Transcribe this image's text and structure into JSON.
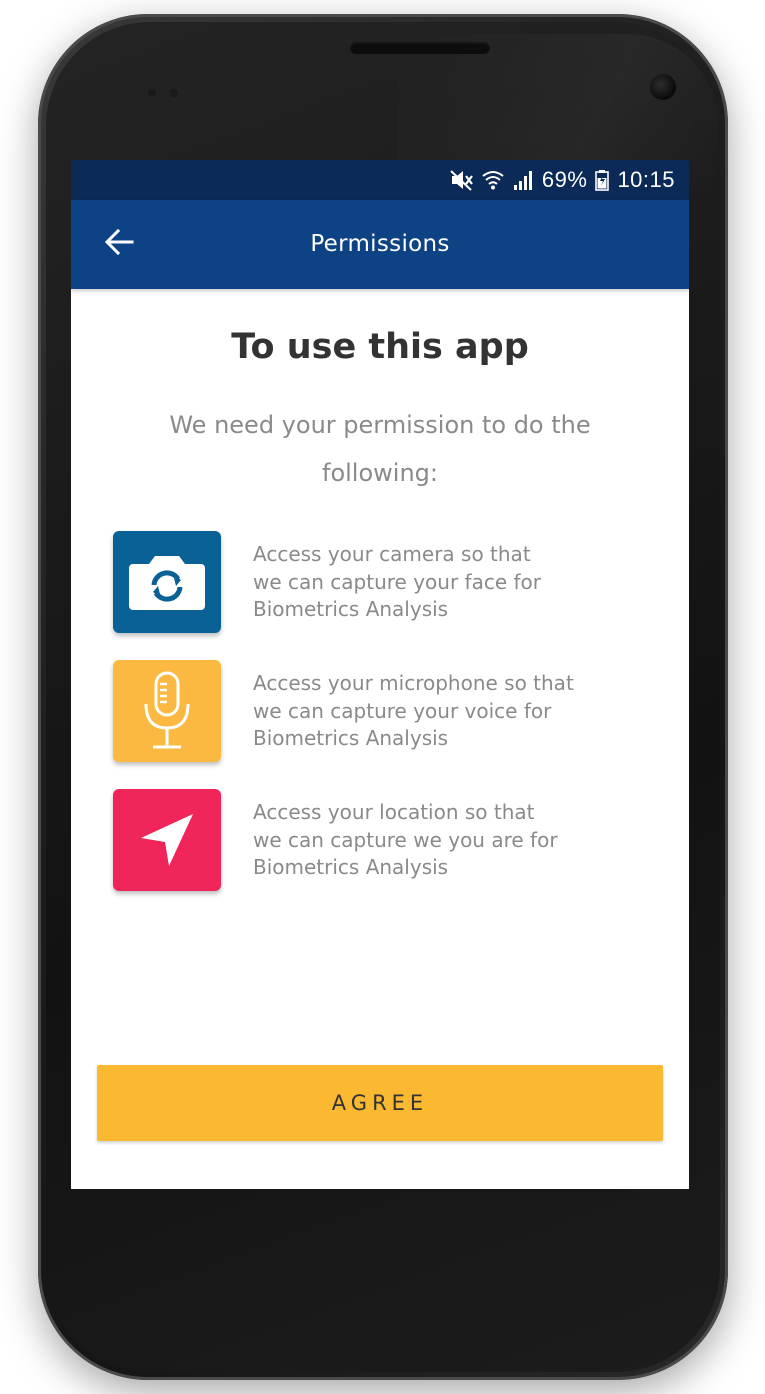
{
  "status_bar": {
    "battery": "69%",
    "time": "10:15",
    "icons": [
      "mute-icon",
      "wifi-icon",
      "signal-icon",
      "battery-icon"
    ]
  },
  "app_bar": {
    "title": "Permissions",
    "back_icon": "arrow-left-icon"
  },
  "main": {
    "heading": "To use this app",
    "subheading": "We need your permission to do the following:",
    "permissions": [
      {
        "icon": "camera-icon",
        "color": "#0a6196",
        "lines": [
          "Access your camera so that",
          "we can capture your face for",
          "Biometrics Analysis"
        ]
      },
      {
        "icon": "microphone-icon",
        "color": "#fbb942",
        "lines": [
          "Access your microphone so that",
          "we can capture your voice for",
          "Biometrics Analysis"
        ]
      },
      {
        "icon": "location-arrow-icon",
        "color": "#f0255a",
        "lines": [
          "Access your location so that",
          "we can capture we you are for",
          "Biometrics Analysis"
        ]
      }
    ],
    "agree_label": "AGREE"
  },
  "colors": {
    "status_bar": "#0b2a57",
    "app_bar": "#0d4285",
    "button": "#fbb932",
    "heading_text": "#333333",
    "body_text": "#8a8a8a"
  }
}
